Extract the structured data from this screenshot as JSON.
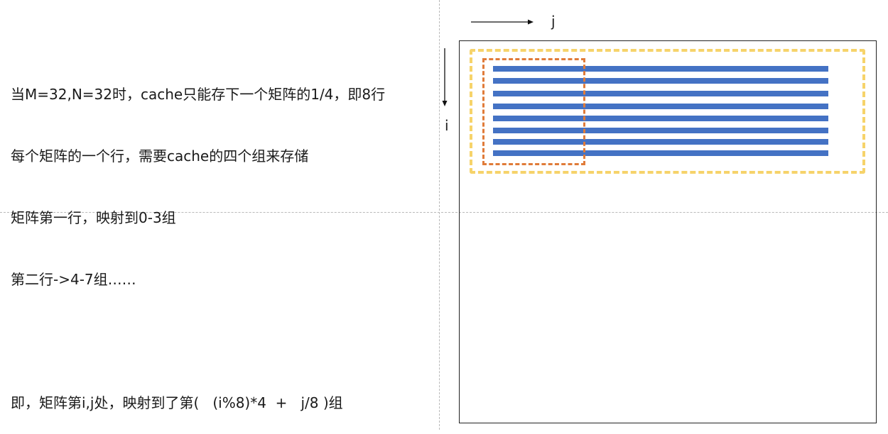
{
  "notes": {
    "lines": [
      "当M=32,N=32时，cache只能存下一个矩阵的1/4，即8行",
      "每个矩阵的一个行，需要cache的四个组来存储",
      "矩阵第一行，映射到0-3组",
      "第二行->4-7组……",
      "",
      "即，矩阵第i,j处，映射到了第(   (i%8)*4  +   j/8 )组"
    ]
  },
  "diagram": {
    "axis_j_label": "j",
    "axis_i_label": "i",
    "row_count": 8,
    "colors": {
      "row_bar": "#4472c4",
      "cache_box": "#f6d36a",
      "block_box": "#e07b39",
      "matrix_border": "#222222"
    }
  }
}
